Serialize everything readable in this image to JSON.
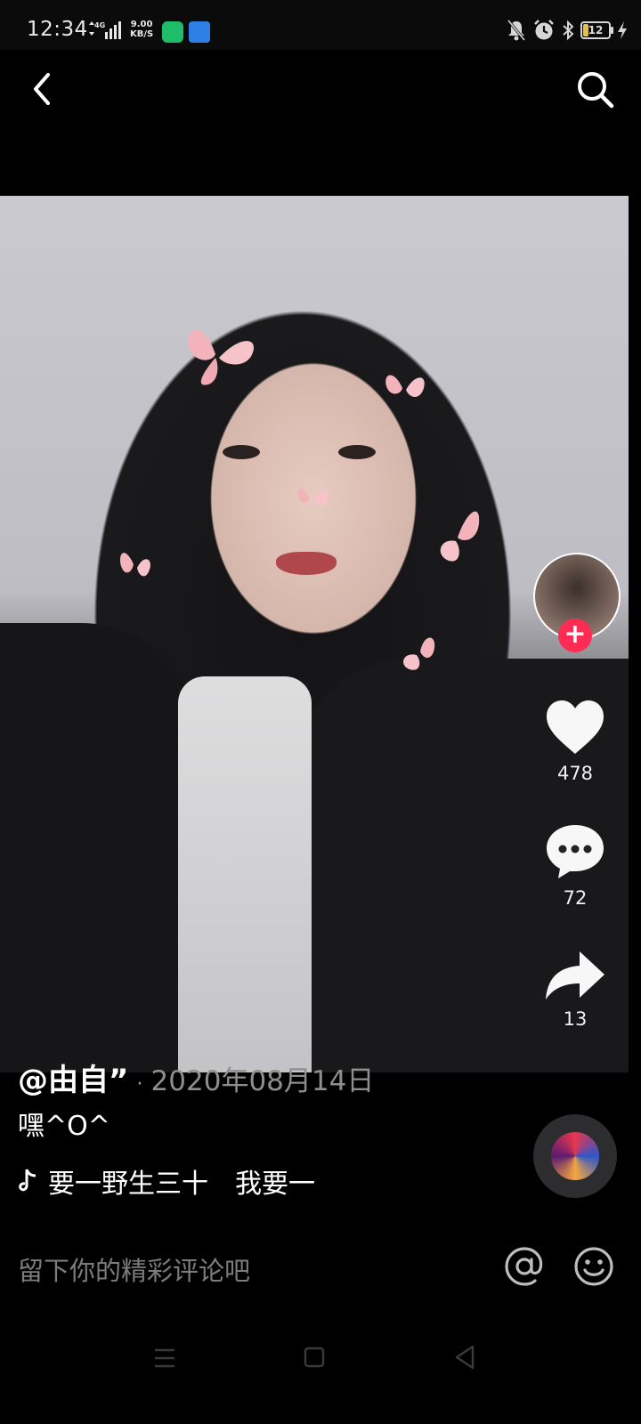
{
  "status_bar": {
    "time": "12:34",
    "network": "4G",
    "speed_value": "9.00",
    "speed_unit": "KB/S",
    "battery": "12"
  },
  "header": {
    "back_icon": "chevron-left-icon",
    "search_icon": "search-icon"
  },
  "actions": {
    "likes": "478",
    "comments": "72",
    "shares": "13",
    "follow_symbol": "+"
  },
  "post": {
    "author": "@由自”",
    "separator": "·",
    "date": "2020年08月14日",
    "description": "嘿^O^",
    "music": "要一野生三十　我要一"
  },
  "comment_bar": {
    "placeholder": "留下你的精彩评论吧"
  },
  "colors": {
    "accent": "#fe2c55",
    "background": "#000000",
    "date_text": "#8e8e8e",
    "placeholder_text": "#7c7c7c"
  }
}
